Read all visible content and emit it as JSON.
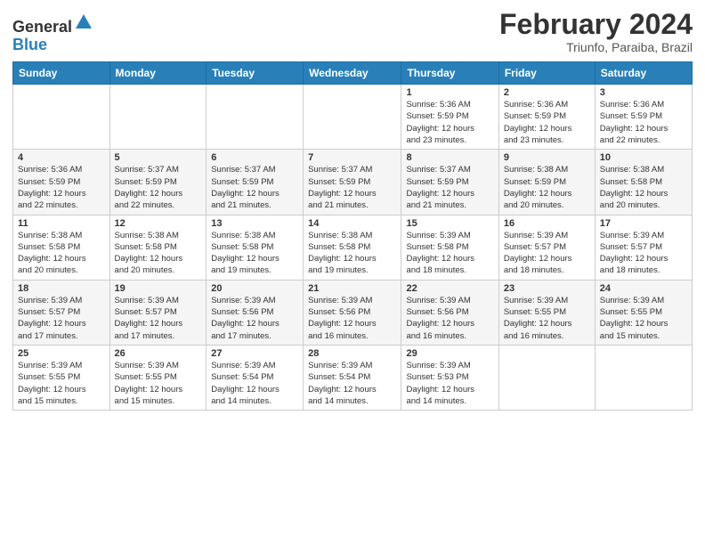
{
  "header": {
    "logo_general": "General",
    "logo_blue": "Blue",
    "month_title": "February 2024",
    "location": "Triunfo, Paraiba, Brazil"
  },
  "days_of_week": [
    "Sunday",
    "Monday",
    "Tuesday",
    "Wednesday",
    "Thursday",
    "Friday",
    "Saturday"
  ],
  "weeks": [
    [
      {
        "day": "",
        "info": ""
      },
      {
        "day": "",
        "info": ""
      },
      {
        "day": "",
        "info": ""
      },
      {
        "day": "",
        "info": ""
      },
      {
        "day": "1",
        "info": "Sunrise: 5:36 AM\nSunset: 5:59 PM\nDaylight: 12 hours\nand 23 minutes."
      },
      {
        "day": "2",
        "info": "Sunrise: 5:36 AM\nSunset: 5:59 PM\nDaylight: 12 hours\nand 23 minutes."
      },
      {
        "day": "3",
        "info": "Sunrise: 5:36 AM\nSunset: 5:59 PM\nDaylight: 12 hours\nand 22 minutes."
      }
    ],
    [
      {
        "day": "4",
        "info": "Sunrise: 5:36 AM\nSunset: 5:59 PM\nDaylight: 12 hours\nand 22 minutes."
      },
      {
        "day": "5",
        "info": "Sunrise: 5:37 AM\nSunset: 5:59 PM\nDaylight: 12 hours\nand 22 minutes."
      },
      {
        "day": "6",
        "info": "Sunrise: 5:37 AM\nSunset: 5:59 PM\nDaylight: 12 hours\nand 21 minutes."
      },
      {
        "day": "7",
        "info": "Sunrise: 5:37 AM\nSunset: 5:59 PM\nDaylight: 12 hours\nand 21 minutes."
      },
      {
        "day": "8",
        "info": "Sunrise: 5:37 AM\nSunset: 5:59 PM\nDaylight: 12 hours\nand 21 minutes."
      },
      {
        "day": "9",
        "info": "Sunrise: 5:38 AM\nSunset: 5:59 PM\nDaylight: 12 hours\nand 20 minutes."
      },
      {
        "day": "10",
        "info": "Sunrise: 5:38 AM\nSunset: 5:58 PM\nDaylight: 12 hours\nand 20 minutes."
      }
    ],
    [
      {
        "day": "11",
        "info": "Sunrise: 5:38 AM\nSunset: 5:58 PM\nDaylight: 12 hours\nand 20 minutes."
      },
      {
        "day": "12",
        "info": "Sunrise: 5:38 AM\nSunset: 5:58 PM\nDaylight: 12 hours\nand 20 minutes."
      },
      {
        "day": "13",
        "info": "Sunrise: 5:38 AM\nSunset: 5:58 PM\nDaylight: 12 hours\nand 19 minutes."
      },
      {
        "day": "14",
        "info": "Sunrise: 5:38 AM\nSunset: 5:58 PM\nDaylight: 12 hours\nand 19 minutes."
      },
      {
        "day": "15",
        "info": "Sunrise: 5:39 AM\nSunset: 5:58 PM\nDaylight: 12 hours\nand 18 minutes."
      },
      {
        "day": "16",
        "info": "Sunrise: 5:39 AM\nSunset: 5:57 PM\nDaylight: 12 hours\nand 18 minutes."
      },
      {
        "day": "17",
        "info": "Sunrise: 5:39 AM\nSunset: 5:57 PM\nDaylight: 12 hours\nand 18 minutes."
      }
    ],
    [
      {
        "day": "18",
        "info": "Sunrise: 5:39 AM\nSunset: 5:57 PM\nDaylight: 12 hours\nand 17 minutes."
      },
      {
        "day": "19",
        "info": "Sunrise: 5:39 AM\nSunset: 5:57 PM\nDaylight: 12 hours\nand 17 minutes."
      },
      {
        "day": "20",
        "info": "Sunrise: 5:39 AM\nSunset: 5:56 PM\nDaylight: 12 hours\nand 17 minutes."
      },
      {
        "day": "21",
        "info": "Sunrise: 5:39 AM\nSunset: 5:56 PM\nDaylight: 12 hours\nand 16 minutes."
      },
      {
        "day": "22",
        "info": "Sunrise: 5:39 AM\nSunset: 5:56 PM\nDaylight: 12 hours\nand 16 minutes."
      },
      {
        "day": "23",
        "info": "Sunrise: 5:39 AM\nSunset: 5:55 PM\nDaylight: 12 hours\nand 16 minutes."
      },
      {
        "day": "24",
        "info": "Sunrise: 5:39 AM\nSunset: 5:55 PM\nDaylight: 12 hours\nand 15 minutes."
      }
    ],
    [
      {
        "day": "25",
        "info": "Sunrise: 5:39 AM\nSunset: 5:55 PM\nDaylight: 12 hours\nand 15 minutes."
      },
      {
        "day": "26",
        "info": "Sunrise: 5:39 AM\nSunset: 5:55 PM\nDaylight: 12 hours\nand 15 minutes."
      },
      {
        "day": "27",
        "info": "Sunrise: 5:39 AM\nSunset: 5:54 PM\nDaylight: 12 hours\nand 14 minutes."
      },
      {
        "day": "28",
        "info": "Sunrise: 5:39 AM\nSunset: 5:54 PM\nDaylight: 12 hours\nand 14 minutes."
      },
      {
        "day": "29",
        "info": "Sunrise: 5:39 AM\nSunset: 5:53 PM\nDaylight: 12 hours\nand 14 minutes."
      },
      {
        "day": "",
        "info": ""
      },
      {
        "day": "",
        "info": ""
      }
    ]
  ]
}
